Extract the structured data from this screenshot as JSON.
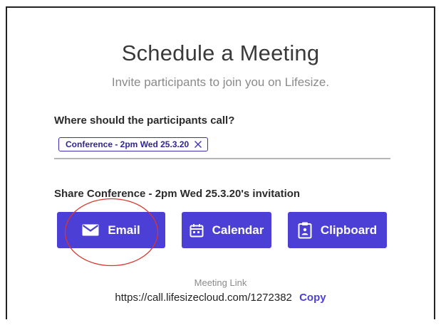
{
  "dialog": {
    "title": "Schedule a Meeting",
    "subtitle": "Invite participants to join you on Lifesize."
  },
  "participants": {
    "question": "Where should the participants call?",
    "selected_chip": "Conference - 2pm Wed 25.3.20",
    "chip_remove_icon": "close-x-icon"
  },
  "share": {
    "heading": "Share Conference - 2pm Wed 25.3.20's invitation",
    "buttons": [
      {
        "label": "Email",
        "icon": "envelope-icon"
      },
      {
        "label": "Calendar",
        "icon": "calendar-icon"
      },
      {
        "label": "Clipboard",
        "icon": "clipboard-icon"
      }
    ]
  },
  "meeting_link": {
    "label": "Meeting Link",
    "url": "https://call.lifesizecloud.com/1272382",
    "copy_label": "Copy"
  },
  "colors": {
    "accent": "#4b3fd6",
    "chip_text": "#2f249e",
    "annotation": "#d9362b",
    "subtle_text": "#8a8a8a"
  }
}
